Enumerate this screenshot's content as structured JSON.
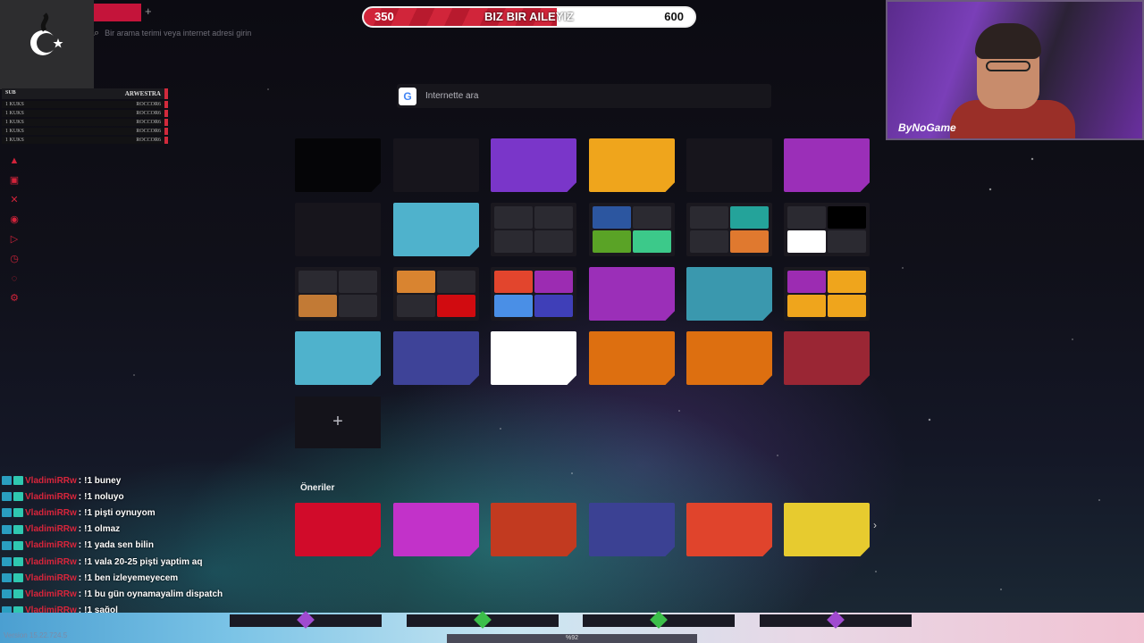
{
  "goal": {
    "current": "350",
    "title": "BIZ BIR AILEYIZ",
    "target": "600",
    "progress_fraction": 0.583
  },
  "browser": {
    "new_tab_symbol": "+",
    "address_placeholder": "Bir arama terimi veya internet adresi girin"
  },
  "leaderboard": {
    "header_left": "SUB",
    "header_right": "ARWESTRA",
    "rows": [
      {
        "left": "1 KUKS",
        "right": "ROCCOR6"
      },
      {
        "left": "1 KUKS",
        "right": "ROCCOR6"
      },
      {
        "left": "1 KUKS",
        "right": "ROCCOR6"
      },
      {
        "left": "1 KUKS",
        "right": "ROCCOR6"
      },
      {
        "left": "1 KUKS",
        "right": "ROCCOR6"
      }
    ]
  },
  "sidebar": {
    "icons": [
      "arc-icon",
      "twitch-icon",
      "x-icon",
      "play-circle-icon",
      "send-icon",
      "history-icon",
      "chat-icon",
      "settings-icon"
    ]
  },
  "search": {
    "placeholder": "İnternette ara",
    "engine_letter": "G"
  },
  "tiles": {
    "add_symbol": "+",
    "colors": {
      "black": "#050507",
      "purple": "#7a36c9",
      "gold": "#efa51c",
      "magenta": "#9b2fb8",
      "sky": "#4fb2cc",
      "teal": "#3a98ae",
      "navy": "#3e4398",
      "white": "#ffffff",
      "orange": "#dd6f10",
      "maroon": "#9a2634"
    }
  },
  "suggestions": {
    "title": "Öneriler",
    "next_symbol": "›",
    "colors": [
      "#d10b2a",
      "#c232c9",
      "#c23a20",
      "#3b4193",
      "#e0442c",
      "#e7cb2f"
    ]
  },
  "webcam": {
    "brand": "ByNoGame"
  },
  "chat": [
    {
      "user": "VladimiRRw",
      "msg": "!1 buney"
    },
    {
      "user": "VladimiRRw",
      "msg": "!1 noluyo"
    },
    {
      "user": "VladimiRRw",
      "msg": "!1 pişti oynuyom"
    },
    {
      "user": "VladimiRRw",
      "msg": "!1 olmaz"
    },
    {
      "user": "VladimiRRw",
      "msg": "!1 yada sen bilin"
    },
    {
      "user": "VladimiRRw",
      "msg": "!1 vala 20-25 pişti yaptim aq"
    },
    {
      "user": "VladimiRRw",
      "msg": "!1 ben izleyemeyecem"
    },
    {
      "user": "VladimiRRw",
      "msg": "!1 bu gün oynamayalim dispatch"
    },
    {
      "user": "VladimiRRw",
      "msg": "!1 sağol"
    }
  ],
  "bottom": {
    "version": "Version 15.22.724.5",
    "center": "%92"
  }
}
